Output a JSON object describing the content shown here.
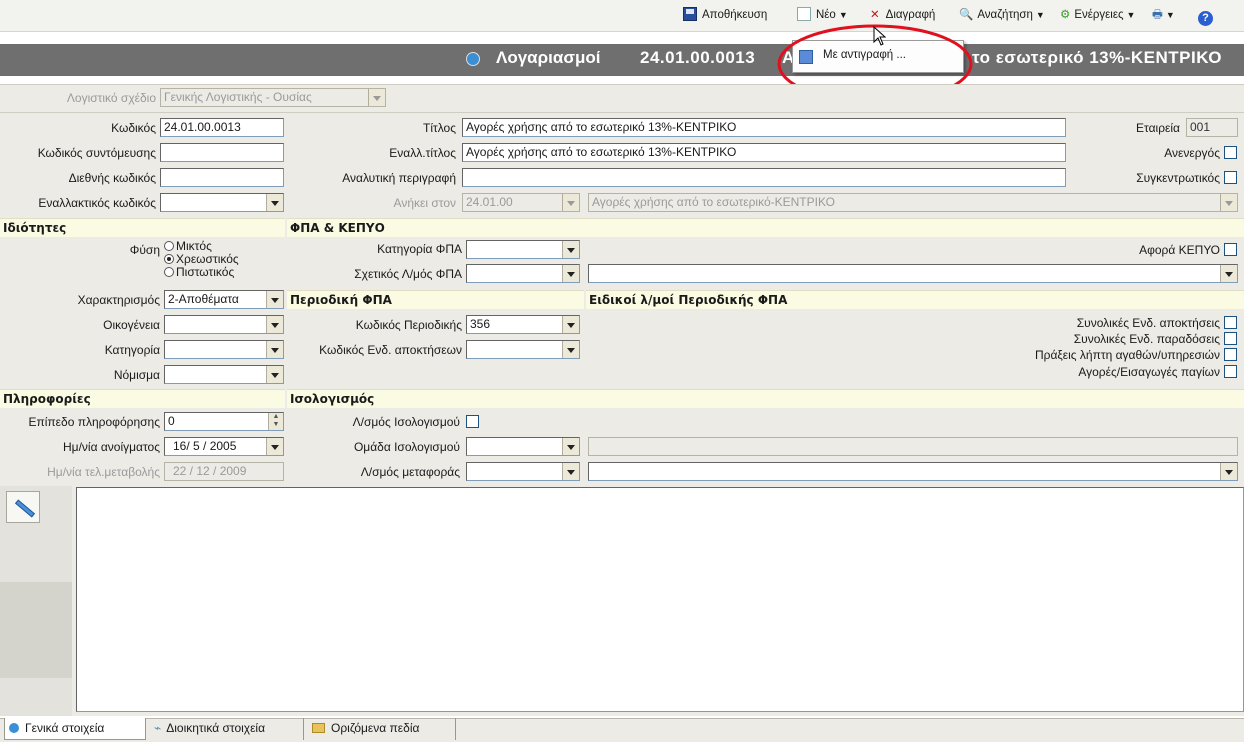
{
  "toolbar": {
    "save": "Αποθήκευση",
    "new": "Νέο",
    "delete": "Διαγραφή",
    "search": "Αναζήτηση",
    "actions": "Ενέργειες"
  },
  "dropdown": {
    "copy_item": "Με αντιγραφή ..."
  },
  "titlebar": {
    "module": "Λογαριασμοί",
    "code": "24.01.00.0013",
    "code_tail": "Α",
    "rest": "το εσωτερικό 13%-ΚΕΝΤΡΙΚΟ"
  },
  "chart_plan": {
    "label": "Λογιστικό σχέδιο",
    "value": "Γενικής Λογιστικής - Ουσίας"
  },
  "fields": {
    "code_label": "Κωδικός",
    "code_value": "24.01.00.0013",
    "abbr_label": "Κωδικός συντόμευσης",
    "abbr_value": "",
    "intl_label": "Διεθνής κωδικός",
    "intl_value": "",
    "alt_label": "Εναλλακτικός κωδικός",
    "alt_value": "",
    "title_label": "Τίτλος",
    "title_value": "Αγορές χρήσης από το εσωτερικό 13%-ΚΕΝΤΡΙΚΟ",
    "alttitle_label": "Εναλλ.τίτλος",
    "alttitle_value": "Αγορές χρήσης από το εσωτερικό 13%-ΚΕΝΤΡΙΚΟ",
    "desc_label": "Αναλυτική περιγραφή",
    "desc_value": "",
    "belongs_label": "Ανήκει στον",
    "belongs_code": "24.01.00",
    "belongs_desc": "Αγορές χρήσης από το εσωτερικό-ΚΕΝΤΡΙΚΟ",
    "company_label": "Εταιρεία",
    "company_value": "001",
    "inactive_label": "Ανενεργός",
    "summary_label": "Συγκεντρωτικός"
  },
  "sections": {
    "properties": "Ιδιότητες",
    "vat": "ΦΠΑ & ΚΕΠΥΟ",
    "periodic": "Περιοδική ΦΠΑ",
    "special": "Ειδικοί λ/μοί Περιοδικής ΦΠΑ",
    "info": "Πληροφορίες",
    "balance": "Ισολογισμός"
  },
  "properties": {
    "nature_label": "Φύση",
    "radio_mixed": "Μικτός",
    "radio_debit": "Χρεωστικός",
    "radio_credit": "Πιστωτικός",
    "char_label": "Χαρακτηρισμός",
    "char_value": "2-Αποθέματα",
    "family_label": "Οικογένεια",
    "category_label": "Κατηγορία",
    "currency_label": "Νόμισμα"
  },
  "vat": {
    "vat_cat_label": "Κατηγορία ΦΠΑ",
    "rel_vat_label": "Σχετικός Λ/μός ΦΠΑ",
    "kepyo_label": "Αφορά ΚΕΠΥΟ",
    "periodic_code_label": "Κωδικός Περιοδικής",
    "periodic_code_value": "356",
    "intra_code_label": "Κωδικός Ενδ. αποκτήσεων"
  },
  "special": {
    "s1": "Συνολικές Ενδ. αποκτήσεις",
    "s2": "Συνολικές Ενδ. παραδόσεις",
    "s3": "Πράξεις λήπτη αγαθών/υπηρεσιών",
    "s4": "Αγορές/Εισαγωγές παγίων"
  },
  "info": {
    "level_label": "Επίπεδο πληροφόρησης",
    "level_value": "0",
    "open_label": "Ημ/νία ανοίγματος",
    "open_value": "16/  5 / 2005",
    "change_label": "Ημ/νία τελ.μεταβολής",
    "change_value": "22 / 12 / 2009"
  },
  "balance": {
    "bs_label": "Λ/σμός Ισολογισμού",
    "group_label": "Ομάδα Ισολογισμού",
    "transfer_label": "Λ/σμός μεταφοράς"
  },
  "tabs": [
    "Γενικά στοιχεία",
    "Διοικητικά στοιχεία",
    "Οριζόμενα πεδία"
  ],
  "colors": {
    "title_bg": "#6f6f6f",
    "section_bg": "#fbfbe4",
    "annotation": "#e0101e"
  }
}
